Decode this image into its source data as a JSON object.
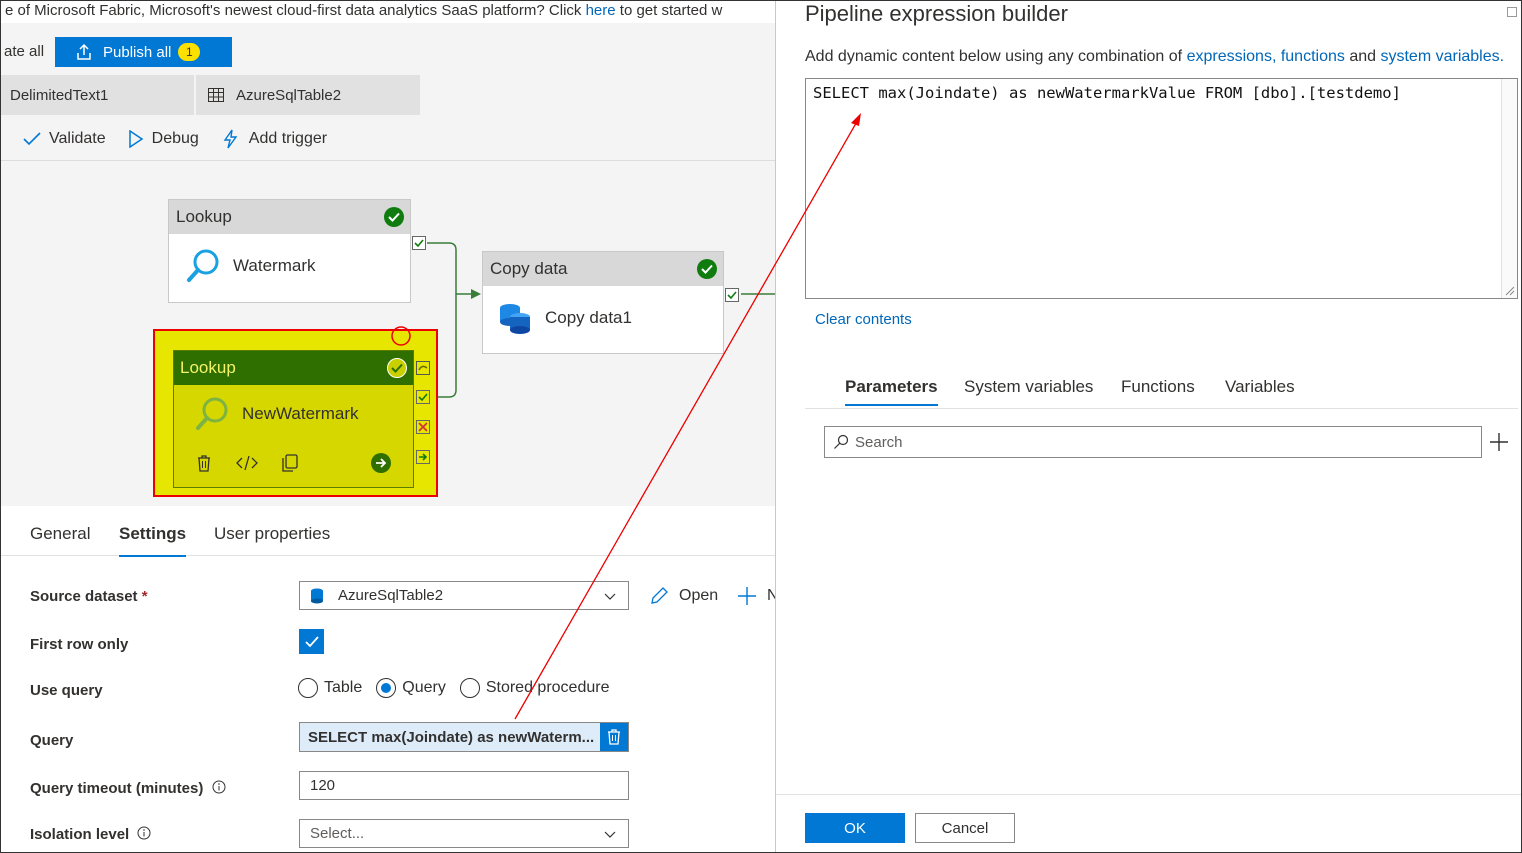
{
  "banner": {
    "text_before": "e of Microsoft Fabric, Microsoft's newest cloud-first data analytics SaaS platform? Click ",
    "link": "here",
    "text_after": " to get started w"
  },
  "publish": {
    "discard_label": "ate all",
    "publish_label": "Publish all",
    "badge": "1"
  },
  "editor_tabs": [
    "DelimitedText1",
    "AzureSqlTable2"
  ],
  "toolbar": {
    "validate": "Validate",
    "debug": "Debug",
    "add_trigger": "Add trigger"
  },
  "activities": {
    "lookup1": {
      "type": "Lookup",
      "name": "Watermark"
    },
    "copy": {
      "type": "Copy data",
      "name": "Copy data1"
    },
    "lookup2": {
      "type": "Lookup",
      "name": "NewWatermark"
    }
  },
  "props": {
    "tabs": [
      "General",
      "Settings",
      "User properties"
    ],
    "active_tab": "Settings",
    "source_dataset_label": "Source dataset",
    "required_mark": "*",
    "source_dataset_value": "AzureSqlTable2",
    "open_label": "Open",
    "new_label": "N",
    "first_row_only_label": "First row only",
    "first_row_only_checked": true,
    "use_query_label": "Use query",
    "use_query_options": [
      "Table",
      "Query",
      "Stored procedure"
    ],
    "use_query_selected": "Query",
    "query_label": "Query",
    "query_value": "SELECT max(Joindate) as newWaterm...",
    "timeout_label": "Query timeout (minutes)",
    "timeout_value": "120",
    "isolation_label": "Isolation level",
    "isolation_placeholder": "Select..."
  },
  "dialog": {
    "title": "Pipeline expression builder",
    "subtitle_before": "Add dynamic content below using any combination of ",
    "subtitle_link1": "expressions, functions",
    "subtitle_mid": " and ",
    "subtitle_link2": "system variables.",
    "expression": "SELECT max(Joindate) as newWatermarkValue FROM [dbo].[testdemo]",
    "clear_contents": "Clear contents",
    "tabs": [
      "Parameters",
      "System variables",
      "Functions",
      "Variables"
    ],
    "active_tab": "Parameters",
    "search_placeholder": "Search",
    "ok_label": "OK",
    "cancel_label": "Cancel"
  },
  "colors": {
    "accent": "#0078d4",
    "success": "#107c10",
    "highlight": "#e6e600",
    "annotation": "#e00000"
  }
}
